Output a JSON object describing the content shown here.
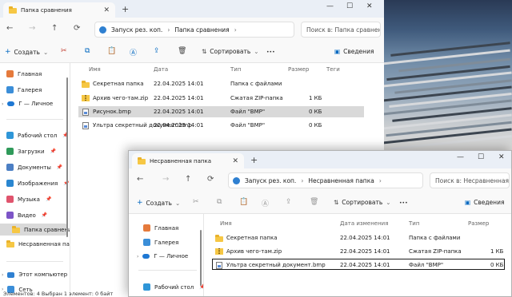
{
  "back_window": {
    "tab_title": "Папка сравнения",
    "address_root": "Запуск рез. коп.",
    "address_current": "Папка сравнения",
    "search_placeholder": "Поиск в: Папка сравнения",
    "toolbar": {
      "create": "Создать",
      "sort": "Сортировать",
      "details": "Сведения"
    },
    "sidebar": [
      "Главная",
      "Галерея",
      "Г — Личное",
      "Рабочий стол",
      "Загрузки",
      "Документы",
      "Изображения",
      "Музыка",
      "Видео",
      "Папка сравнения",
      "Несравненная папка",
      "Этот компьютер",
      "Сеть"
    ],
    "columns": {
      "name": "Имя",
      "date": "Дата",
      "type": "Тип",
      "size": "Размер",
      "tags": "Теги"
    },
    "rows": [
      {
        "name": "Секретная папка",
        "date": "22.04.2025 14:01",
        "type": "Папка с файлами",
        "size": ""
      },
      {
        "name": "Архив чего-там.zip",
        "date": "22.04.2025 14:01",
        "type": "Сжатая ZIP-папка",
        "size": "1 КБ"
      },
      {
        "name": "Рисунок.bmp",
        "date": "22.04.2025 14:01",
        "type": "Файл \"BMP\"",
        "size": "0 КБ"
      },
      {
        "name": "Ультра секретный документ.bmp",
        "date": "22.04.2025 14:01",
        "type": "Файл \"BMP\"",
        "size": "0 КБ"
      }
    ],
    "status": "Элементов: 4    Выбран 1 элемент: 0 байт"
  },
  "front_window": {
    "tab_title": "Несравненная папка",
    "address_root": "Запуск рез. коп.",
    "address_current": "Несравненная папка",
    "search_placeholder": "Поиск в: Несравненная папка",
    "toolbar": {
      "create": "Создать",
      "sort": "Сортировать",
      "details": "Сведения"
    },
    "sidebar": [
      "Главная",
      "Галерея",
      "Г — Личное",
      "Рабочий стол"
    ],
    "columns": {
      "name": "Имя",
      "date": "Дата изменения",
      "type": "Тип",
      "size": "Размер"
    },
    "rows": [
      {
        "name": "Секретная папка",
        "date": "22.04.2025 14:01",
        "type": "Папка с файлами",
        "size": ""
      },
      {
        "name": "Архив чего-там.zip",
        "date": "22.04.2025 14:01",
        "type": "Сжатая ZIP-папка",
        "size": "1 КБ"
      },
      {
        "name": "Ультра секретный документ.bmp",
        "date": "22.04.2025 14:01",
        "type": "Файл \"BMP\"",
        "size": "0 КБ"
      }
    ]
  },
  "glyphs": {
    "back": "←",
    "forward": "→",
    "up": "↑",
    "refresh": "⟳",
    "sep": "›",
    "more": "•••",
    "plus": "+",
    "close": "✕",
    "min": "—",
    "max": "☐",
    "chevdown": "⌄",
    "pin": "📌"
  },
  "colors": {
    "accent": "#0067c0",
    "folder": "#f6c744",
    "selection": "#d9d9d9"
  }
}
